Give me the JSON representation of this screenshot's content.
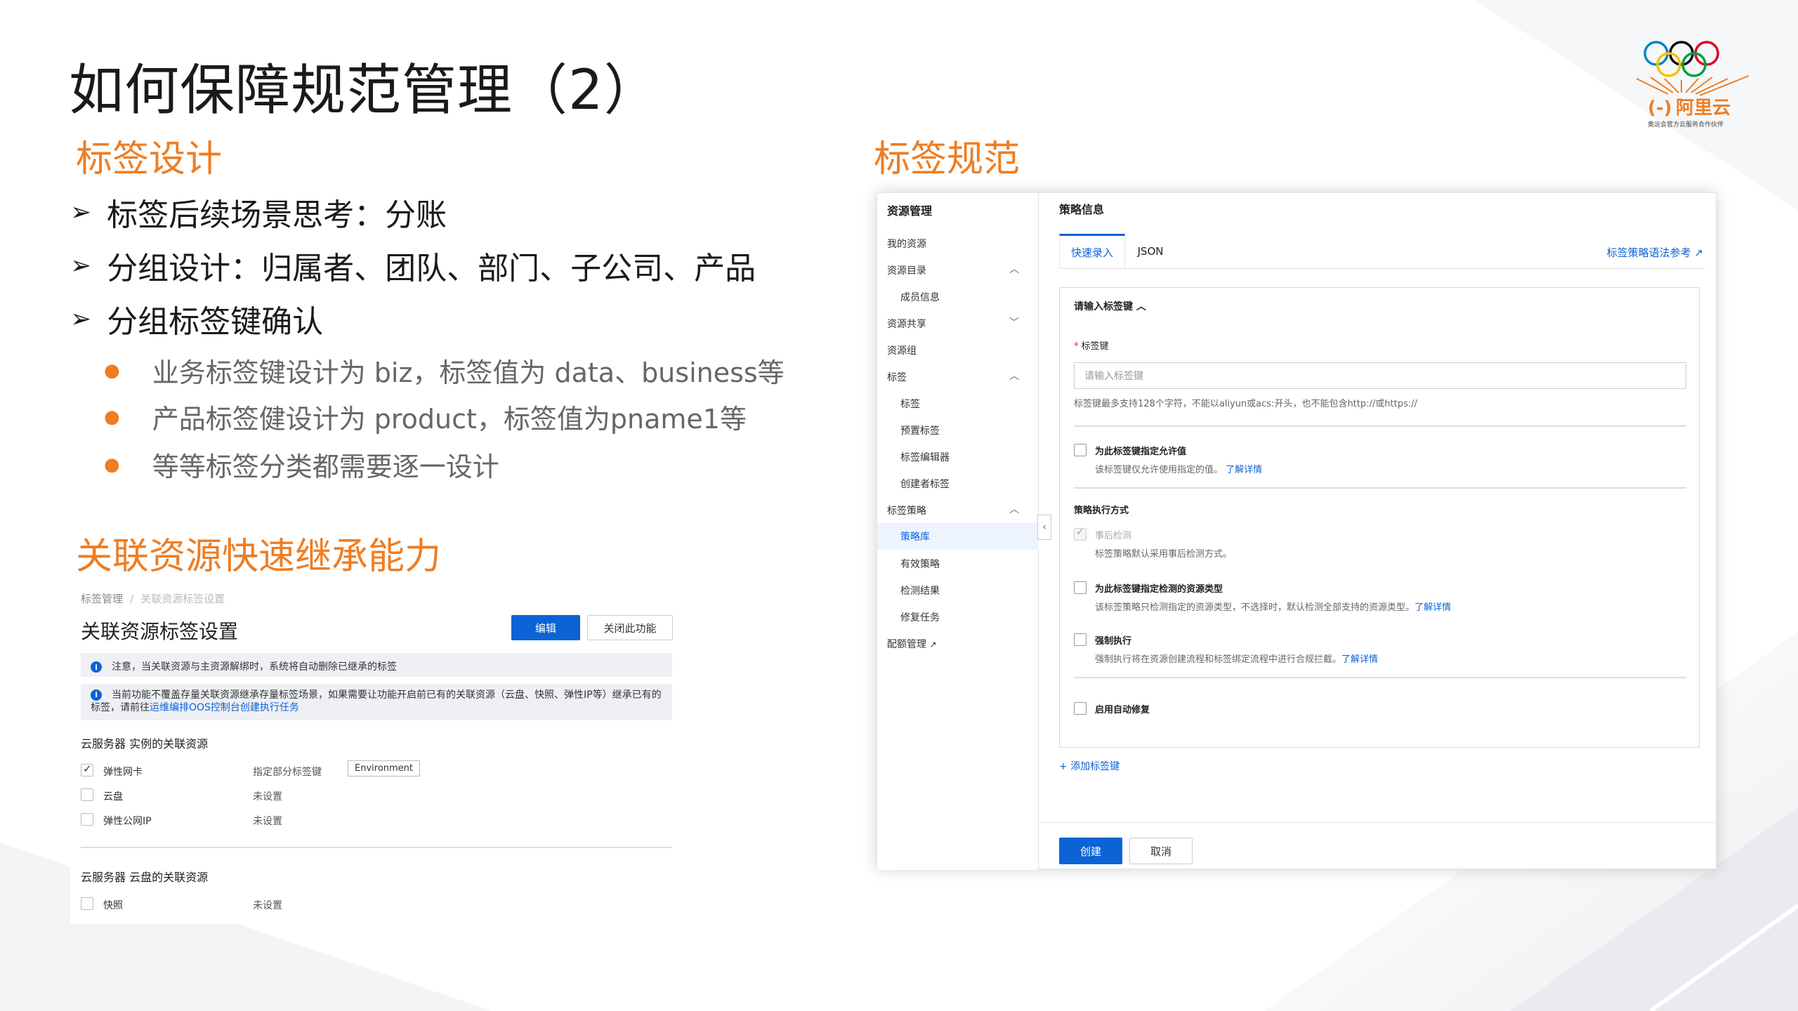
{
  "slide": {
    "title": "如何保障规范管理（2）",
    "logo_text": "阿里云",
    "logo_tagline": "奥运会官方云服务合作伙伴"
  },
  "left": {
    "heading1": "标签设计",
    "bullets": [
      "标签后续场景思考：分账",
      "分组设计：归属者、团队、部门、子公司、产品",
      "分组标签键确认"
    ],
    "sub_bullets": [
      "业务标签键设计为 biz，标签值为 data、business等",
      "产品标签健设计为 product，标签值为pname1等",
      "等等标签分类都需要逐一设计"
    ],
    "heading2": "关联资源快速继承能力"
  },
  "inherit_ui": {
    "breadcrumb": [
      "标签管理",
      "关联资源标签设置"
    ],
    "title": "关联资源标签设置",
    "edit_button": "编辑",
    "disable_button": "关闭此功能",
    "notice1": "注意，当关联资源与主资源解绑时，系统将自动删除已继承的标签",
    "notice2": "当前功能不覆盖存量关联资源继承存量标签场景，如果需要让功能开启前已有的关联资源（云盘、快照、弹性IP等）继承已有的标签，请前往",
    "notice2_link": "运维编排OOS控制台创建执行任务",
    "section1": "云服务器 实例的关联资源",
    "rows1": [
      {
        "label": "弹性网卡",
        "checked": true,
        "value": "指定部分标签键",
        "tag": "Environment"
      },
      {
        "label": "云盘",
        "checked": false,
        "value": "未设置"
      },
      {
        "label": "弹性公网IP",
        "checked": false,
        "value": "未设置"
      }
    ],
    "section2": "云服务器 云盘的关联资源",
    "rows2": [
      {
        "label": "快照",
        "checked": false,
        "value": "未设置"
      }
    ]
  },
  "right": {
    "heading": "标签规范"
  },
  "policy_ui": {
    "sidebar_title": "资源管理",
    "nav": {
      "my_resources": "我的资源",
      "resource_dir": "资源目录",
      "member_info": "成员信息",
      "resource_share": "资源共享",
      "resource_group": "资源组",
      "tags": "标签",
      "tag": "标签",
      "preset_tags": "预置标签",
      "tag_editor": "标签编辑器",
      "creator_tags": "创建者标签",
      "tag_policy": "标签策略",
      "policy_lib": "策略库",
      "effective_policy": "有效策略",
      "detection_results": "检测结果",
      "fix_tasks": "修复任务",
      "quota_mgmt": "配额管理"
    },
    "main_title": "策略信息",
    "tabs": [
      "快速录入",
      "JSON"
    ],
    "syntax_link": "标签策略语法参考",
    "key_dropdown": "请输入标签键",
    "key_label": "标签键",
    "key_placeholder": "请输入标签键",
    "key_hint": "标签键最多支持128个字符，不能以aliyun或acs:开头，也不能包含http://或https://",
    "allow_label": "为此标签键指定允许值",
    "allow_hint": "该标签键仅允许使用指定的值。",
    "learn_more": "了解详情",
    "exec_title": "策略执行方式",
    "post_detect": "事后检测",
    "post_detect_hint": "标签策略默认采用事后检测方式。",
    "res_type_label": "为此标签键指定检测的资源类型",
    "res_type_hint": "该标签策略只检测指定的资源类型，不选择时，默认检测全部支持的资源类型。",
    "enforce_label": "强制执行",
    "enforce_hint": "强制执行将在资源创建流程和标签绑定流程中进行合规拦截。",
    "auto_fix_label": "启用自动修复",
    "add_key": "添加标签键",
    "create_button": "创建",
    "cancel_button": "取消"
  },
  "colors": {
    "accent_orange": "#ef7d22",
    "primary_blue": "#0b63d6"
  }
}
